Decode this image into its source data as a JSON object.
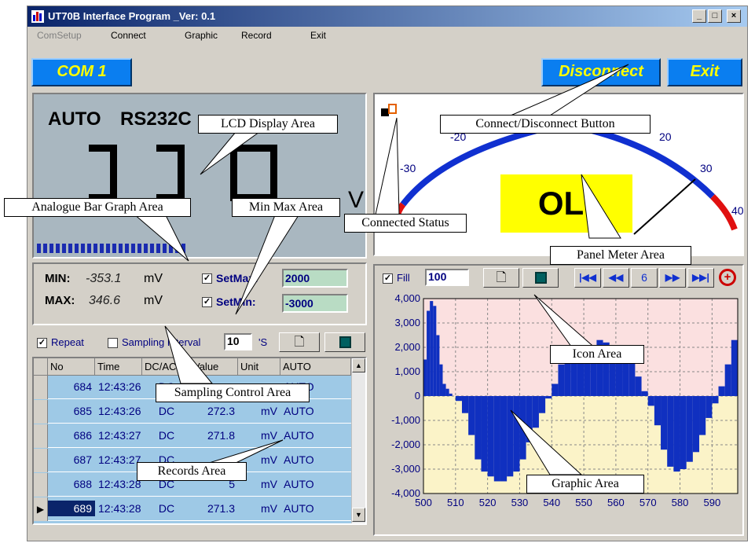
{
  "window": {
    "title": "UT70B Interface Program _Ver: 0.1",
    "min": "_",
    "max": "□",
    "close": "×"
  },
  "menu": [
    "ComSetup",
    "Connect",
    "Graphic",
    "Record",
    "Exit"
  ],
  "com_port": "COM 1",
  "buttons": {
    "disconnect": "Disconnect",
    "exit": "Exit"
  },
  "lcd": {
    "mode": "AUTO",
    "interface": "RS232C",
    "unit_fragment": "V"
  },
  "minmax": {
    "min_label": "MIN:",
    "min_value": "-353.1",
    "min_unit": "mV",
    "max_label": "MAX:",
    "max_value": "346.6",
    "max_unit": "mV",
    "setmax_label": "SetMax:",
    "setmax_value": "2000",
    "setmin_label": "SetMin:",
    "setmin_value": "-3000",
    "setmax_checked": "☑",
    "setmin_checked": "☑"
  },
  "sampling": {
    "repeat_label": "Repeat",
    "interval_label": "Sampling Interval",
    "interval_value": "10",
    "interval_unit": "'S"
  },
  "records": {
    "columns": [
      "No",
      "Time",
      "DC/AC",
      "Value",
      "Unit",
      "AUTO"
    ],
    "rows": [
      {
        "no": "684",
        "time": "12:43:26",
        "type": "DC",
        "value": "",
        "unit": "",
        "mode": "AUTO"
      },
      {
        "no": "685",
        "time": "12:43:26",
        "type": "DC",
        "value": "272.3",
        "unit": "mV",
        "mode": "AUTO"
      },
      {
        "no": "686",
        "time": "12:43:27",
        "type": "DC",
        "value": "271.8",
        "unit": "mV",
        "mode": "AUTO"
      },
      {
        "no": "687",
        "time": "12:43:27",
        "type": "DC",
        "value": "",
        "unit": "mV",
        "mode": "AUTO"
      },
      {
        "no": "688",
        "time": "12:43:28",
        "type": "DC",
        "value": "5",
        "unit": "mV",
        "mode": "AUTO"
      },
      {
        "no": "689",
        "time": "12:43:28",
        "type": "DC",
        "value": "271.3",
        "unit": "mV",
        "mode": "AUTO"
      }
    ]
  },
  "meter": {
    "scale_labels": [
      "-30",
      "-20",
      "20",
      "30",
      "40"
    ],
    "readout": "OL!"
  },
  "graph_toolbar": {
    "fill_label": "Fill",
    "points_value": "100",
    "page_number": "6"
  },
  "chart_data": {
    "type": "area",
    "x_ticks": [
      "500",
      "510",
      "520",
      "530",
      "540",
      "550",
      "560",
      "570",
      "580",
      "590"
    ],
    "y_ticks": [
      "4,000",
      "3,000",
      "2,000",
      "1,000",
      "0",
      "-1,000",
      "-2,000",
      "-3,000",
      "-4,000"
    ],
    "xlim": [
      500,
      598
    ],
    "ylim": [
      -4000,
      4000
    ],
    "x": [
      500,
      501,
      502,
      503,
      504,
      505,
      506,
      507,
      508,
      509,
      510,
      512,
      514,
      516,
      518,
      520,
      522,
      524,
      526,
      528,
      530,
      532,
      534,
      536,
      538,
      540,
      542,
      544,
      546,
      548,
      550,
      552,
      554,
      556,
      558,
      560,
      562,
      564,
      566,
      568,
      570,
      572,
      574,
      576,
      578,
      580,
      582,
      584,
      586,
      588,
      590,
      592,
      594,
      596,
      598
    ],
    "y": [
      1500,
      3500,
      3900,
      3700,
      2500,
      1300,
      500,
      300,
      100,
      0,
      -200,
      -700,
      -1600,
      -2600,
      -3100,
      -3300,
      -3500,
      -3500,
      -3300,
      -3100,
      -2600,
      -1900,
      -1300,
      -700,
      -100,
      500,
      1300,
      1800,
      2000,
      1900,
      1600,
      2000,
      2300,
      2200,
      2000,
      2000,
      1900,
      1500,
      800,
      200,
      -400,
      -1200,
      -2200,
      -2900,
      -3100,
      -3000,
      -2700,
      -2300,
      -1600,
      -900,
      -300,
      400,
      1300,
      2300,
      2400
    ]
  },
  "annotations": {
    "lcd": "LCD Display Area",
    "analogue": "Analogue Bar Graph Area",
    "minmax": "Min Max Area",
    "connected": "Connected Status",
    "connect": "Connect/Disconnect Button",
    "panel": "Panel Meter Area",
    "icon": "Icon Area",
    "sampling": "Sampling Control Area",
    "records": "Records Area",
    "graphic": "Graphic Area"
  }
}
